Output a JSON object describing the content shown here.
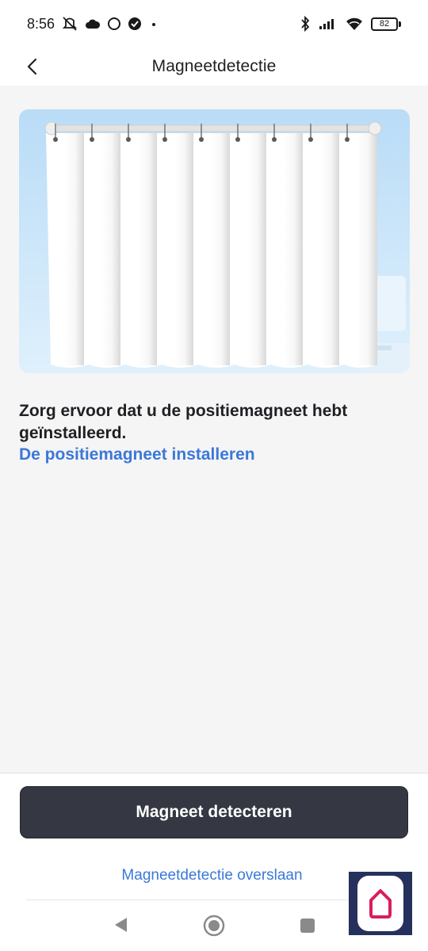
{
  "status_bar": {
    "time": "8:56",
    "battery_level": "82",
    "icons": [
      "mute-icon",
      "cloud-icon",
      "circle-icon",
      "check-circle-icon",
      "dot-icon",
      "bluetooth-icon",
      "signal-icon",
      "wifi-icon",
      "battery-icon"
    ]
  },
  "header": {
    "title": "Magneetdetectie",
    "back_icon": "chevron-left-icon"
  },
  "illustration": {
    "subject": "curtain-illustration",
    "sky_color": "#c9e4f9",
    "curtain_color": "#ffffff"
  },
  "content": {
    "instruction": "Zorg ervoor dat u de positiemagneet hebt geïnstalleerd.",
    "install_link": "De positiemagneet installeren"
  },
  "footer": {
    "primary_button": "Magneet detecteren",
    "skip_link": "Magneetdetectie overslaan"
  },
  "colors": {
    "accent": "#3b78d8",
    "button_bg": "#353842",
    "page_bg": "#f5f5f5"
  },
  "system_nav": {
    "icons": [
      "triangle-back-icon",
      "home-circle-icon",
      "square-recent-icon"
    ]
  },
  "app_badge": {
    "icon": "home-logo-icon",
    "bg_color": "#25315c",
    "logo_color": "#d81e5b"
  }
}
